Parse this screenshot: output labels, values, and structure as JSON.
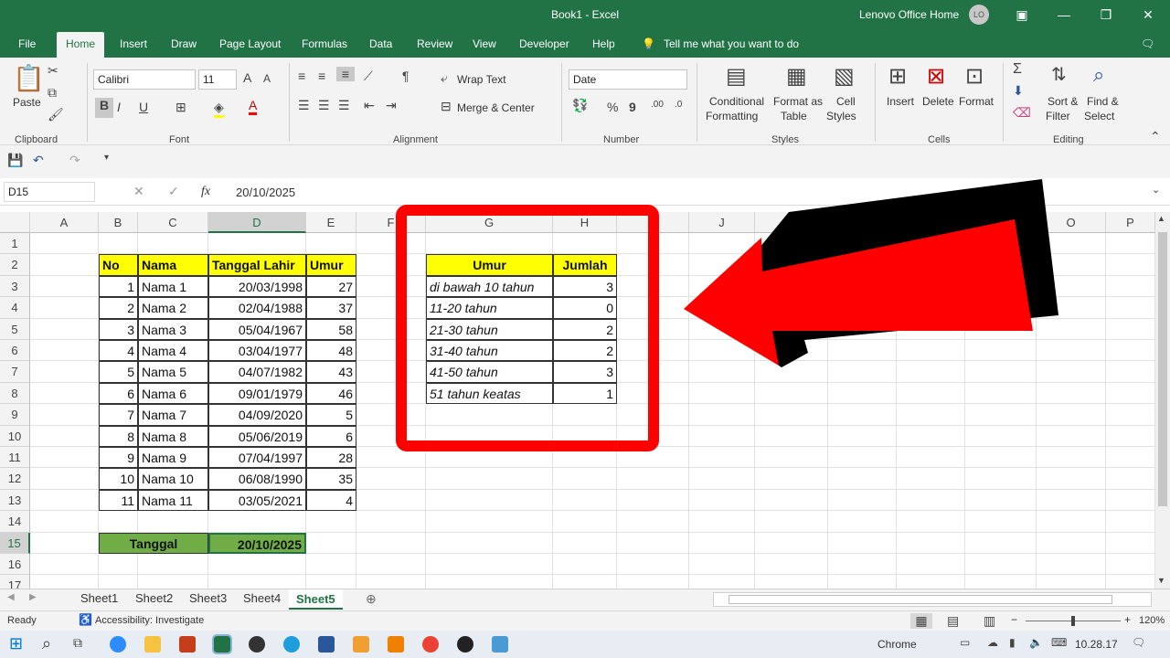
{
  "window": {
    "title": "Book1 - Excel",
    "user": "Lenovo Office Home",
    "initials": "LO"
  },
  "tabs": [
    "File",
    "Home",
    "Insert",
    "Draw",
    "Page Layout",
    "Formulas",
    "Data",
    "Review",
    "View",
    "Developer",
    "Help"
  ],
  "active_tab": "Home",
  "tell_me": "Tell me what you want to do",
  "ribbon": {
    "clipboard": {
      "paste": "Paste",
      "group": "Clipboard"
    },
    "font": {
      "name": "Calibri",
      "size": "11",
      "bold": "B",
      "italic": "I",
      "underline": "U",
      "group": "Font"
    },
    "alignment": {
      "wrap": "Wrap Text",
      "merge": "Merge & Center",
      "group": "Alignment"
    },
    "number": {
      "format": "Date",
      "group": "Number"
    },
    "styles": {
      "cond1": "Conditional",
      "cond2": "Formatting",
      "fmt1": "Format as",
      "fmt2": "Table",
      "cs1": "Cell",
      "cs2": "Styles",
      "group": "Styles"
    },
    "cells": {
      "insert": "Insert",
      "delete": "Delete",
      "format": "Format",
      "group": "Cells"
    },
    "editing": {
      "sort1": "Sort &",
      "sort2": "Filter",
      "find1": "Find &",
      "find2": "Select",
      "group": "Editing"
    }
  },
  "formula_bar": {
    "name_box": "D15",
    "fx": "fx",
    "value": "20/10/2025"
  },
  "columns": [
    "A",
    "B",
    "C",
    "D",
    "E",
    "F",
    "G",
    "H",
    "I",
    "J",
    "K",
    "L",
    "M",
    "N",
    "O",
    "P"
  ],
  "rows": [
    "1",
    "2",
    "3",
    "4",
    "5",
    "6",
    "7",
    "8",
    "9",
    "10",
    "11",
    "12",
    "13",
    "14",
    "15",
    "16",
    "17"
  ],
  "table1": {
    "headers": [
      "No",
      "Nama",
      "Tanggal Lahir",
      "Umur"
    ],
    "rows": [
      [
        "1",
        "Nama 1",
        "20/03/1998",
        "27"
      ],
      [
        "2",
        "Nama 2",
        "02/04/1988",
        "37"
      ],
      [
        "3",
        "Nama 3",
        "05/04/1967",
        "58"
      ],
      [
        "4",
        "Nama 4",
        "03/04/1977",
        "48"
      ],
      [
        "5",
        "Nama 5",
        "04/07/1982",
        "43"
      ],
      [
        "6",
        "Nama 6",
        "09/01/1979",
        "46"
      ],
      [
        "7",
        "Nama 7",
        "04/09/2020",
        "5"
      ],
      [
        "8",
        "Nama 8",
        "05/06/2019",
        "6"
      ],
      [
        "9",
        "Nama 9",
        "07/04/1997",
        "28"
      ],
      [
        "10",
        "Nama 10",
        "06/08/1990",
        "35"
      ],
      [
        "11",
        "Nama 11",
        "03/05/2021",
        "4"
      ]
    ],
    "footer_label": "Tanggal",
    "footer_value": "20/10/2025"
  },
  "table2": {
    "headers": [
      "Umur",
      "Jumlah"
    ],
    "rows": [
      [
        "di bawah 10 tahun",
        "3"
      ],
      [
        "11-20 tahun",
        "0"
      ],
      [
        "21-30 tahun",
        "2"
      ],
      [
        "31-40 tahun",
        "2"
      ],
      [
        "41-50 tahun",
        "3"
      ],
      [
        "51 tahun keatas",
        "1"
      ]
    ]
  },
  "sheets": [
    "Sheet1",
    "Sheet2",
    "Sheet3",
    "Sheet4",
    "Sheet5"
  ],
  "active_sheet": "Sheet5",
  "status": {
    "ready": "Ready",
    "accessibility": "Accessibility: Investigate",
    "zoom": "120%"
  },
  "taskbar": {
    "app": "Chrome",
    "time": "10.28.17"
  },
  "colors": {
    "excel_green": "#217346",
    "header_yellow": "#ffff00",
    "footer_green": "#70ad47",
    "annotation_red": "#ff0000"
  }
}
